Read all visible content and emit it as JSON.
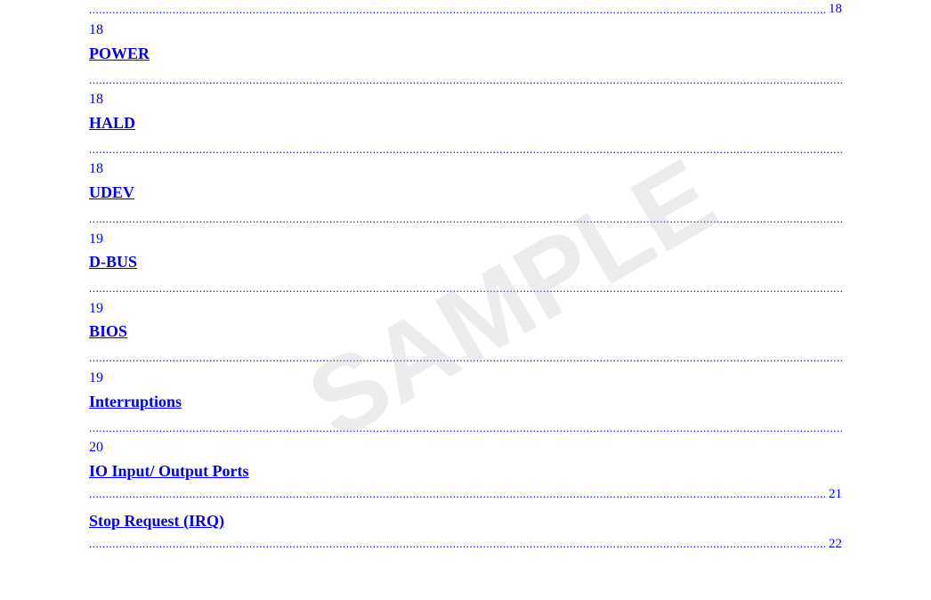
{
  "watermark": {
    "text": "SAMPLE"
  },
  "toc": {
    "entries": [
      {
        "id": "power",
        "dots_before": true,
        "page_before": "18",
        "title": "POWER",
        "dots_after": true,
        "page_after": null
      },
      {
        "id": "hald",
        "dots_before": true,
        "page_before": "18",
        "title": "HALD",
        "dots_after": true,
        "page_after": null
      },
      {
        "id": "udev",
        "dots_before": true,
        "page_before": "18",
        "title": "UDEV",
        "dots_after": true,
        "page_after": null
      },
      {
        "id": "dbus",
        "dots_before": true,
        "page_before": "19",
        "title": "D-BUS",
        "dots_after": true,
        "page_after": null
      },
      {
        "id": "bios",
        "dots_before": true,
        "page_before": "19",
        "title": "BIOS",
        "dots_after": true,
        "page_after": null
      },
      {
        "id": "interruptions",
        "dots_before": true,
        "page_before": "19",
        "title": "Interruptions",
        "dots_after": true,
        "page_after": null
      },
      {
        "id": "io-ports",
        "dots_before": true,
        "page_before": "20",
        "title": "IO Input/ Output Ports",
        "dots_after": true,
        "page_after": "21"
      },
      {
        "id": "stop-request",
        "dots_before": false,
        "page_before": null,
        "title": "Stop Request (IRQ)",
        "dots_after": true,
        "page_after": "22"
      }
    ]
  }
}
